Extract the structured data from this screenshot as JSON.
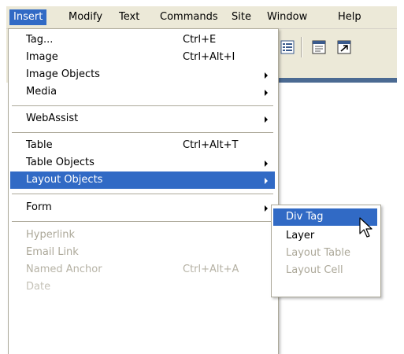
{
  "menubar": {
    "items": [
      "Insert",
      "Modify",
      "Text",
      "Commands",
      "Site",
      "Window",
      "Help"
    ]
  },
  "insert_menu": {
    "items": [
      {
        "label": "Tag...",
        "shortcut": "Ctrl+E"
      },
      {
        "label": "Image",
        "shortcut": "Ctrl+Alt+I"
      },
      {
        "label": "Image Objects",
        "submenu": true
      },
      {
        "label": "Media",
        "submenu": true
      },
      {
        "label": "WebAssist",
        "submenu": true
      },
      {
        "label": "Table",
        "shortcut": "Ctrl+Alt+T"
      },
      {
        "label": "Table Objects",
        "submenu": true
      },
      {
        "label": "Layout Objects",
        "submenu": true,
        "highlighted": true
      },
      {
        "label": "Form",
        "submenu": true
      },
      {
        "label": "Hyperlink",
        "disabled": true
      },
      {
        "label": "Email Link",
        "disabled": true
      },
      {
        "label": "Named Anchor",
        "shortcut": "Ctrl+Alt+A",
        "disabled": true
      },
      {
        "label": "Date",
        "disabled": true
      }
    ]
  },
  "layout_objects_submenu": {
    "items": [
      {
        "label": "Div Tag",
        "highlighted": true
      },
      {
        "label": "Layer"
      },
      {
        "label": "Layout Table",
        "disabled": true
      },
      {
        "label": "Layout Cell",
        "disabled": true
      }
    ]
  },
  "colors": {
    "menubar_bg": "#ece9d8",
    "highlight": "#316ac5",
    "disabled_text": "#aca899"
  }
}
